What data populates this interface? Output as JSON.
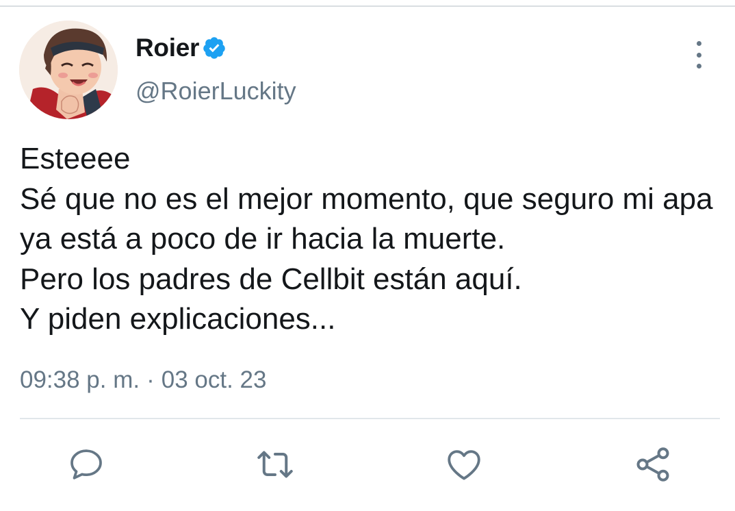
{
  "tweet": {
    "display_name": "Roier",
    "handle": "@RoierLuckity",
    "verified": true,
    "text": "Esteeee\nSé que no es el mejor momento, que seguro mi apa ya está a poco de ir hacia la muerte.\nPero los padres de Cellbit están aquí.\nY piden explicaciones...",
    "time": "09:38 p. m.",
    "separator": "·",
    "date": "03 oct. 23"
  },
  "icons": {
    "verified": "verified-badge-icon",
    "more": "more-vertical-icon",
    "reply": "reply-icon",
    "retweet": "retweet-icon",
    "like": "heart-icon",
    "share": "share-icon"
  },
  "colors": {
    "text": "#14171a",
    "secondary": "#657786",
    "verified_blue": "#1da1f2",
    "divider": "#e1e6ea"
  }
}
